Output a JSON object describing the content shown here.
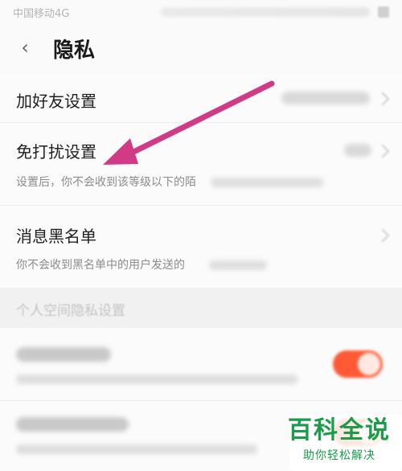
{
  "status_bar": {
    "carrier": "中国移动4G"
  },
  "nav": {
    "back_glyph": "‹",
    "title": "隐私"
  },
  "rows": [
    {
      "title": "加好友设置"
    },
    {
      "title": "免打扰设置",
      "desc": "设置后，你不会收到该等级以下的陌"
    },
    {
      "title": "消息黑名单",
      "desc": "你不会收到黑名单中的用户发送的"
    }
  ],
  "section": {
    "label": "个人空间隐私设置"
  },
  "watermark": {
    "title": "百科全说",
    "subtitle": "助你轻松解决"
  },
  "colors": {
    "accent": "#ff5a36",
    "arrow": "#d13b86",
    "watermark": "#1a9c4a"
  }
}
